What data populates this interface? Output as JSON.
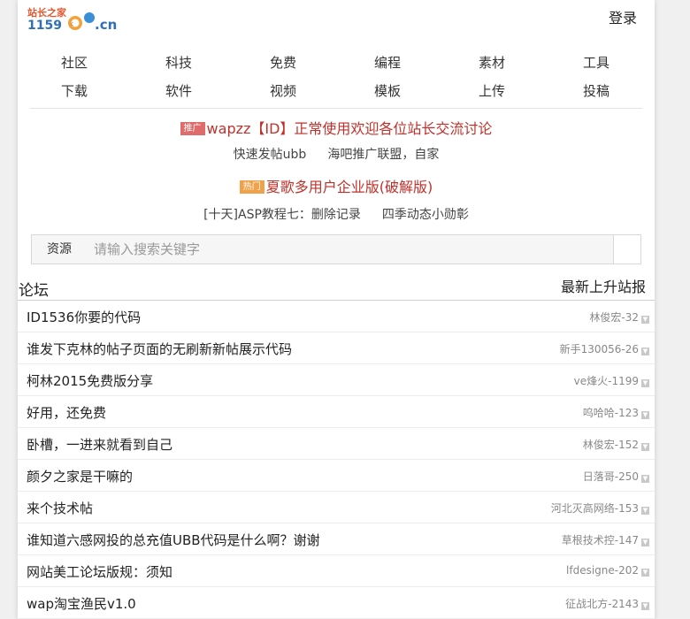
{
  "header": {
    "login_label": "登录"
  },
  "nav": {
    "row1": [
      "社区",
      "科技",
      "免费",
      "编程",
      "素材",
      "工具"
    ],
    "row2": [
      "下载",
      "软件",
      "视频",
      "模板",
      "上传",
      "投稿"
    ]
  },
  "promo1": {
    "badge": "推广",
    "badge_color": "#e06b6b",
    "text": "wapzz【ID】正常使用欢迎各位站长交流讨论",
    "links": [
      "快速发帖ubb",
      "海吧推广联盟，自家"
    ]
  },
  "promo2": {
    "badge": "热门",
    "badge_color": "#f0a24a",
    "text": "夏歌多用户企业版(破解版)",
    "links": [
      "[十天]ASP教程七：删除记录",
      "四季动态小勋彰"
    ]
  },
  "search": {
    "category": "资源",
    "placeholder": "请输入搜索关键字",
    "value": ""
  },
  "section": {
    "title": "论坛",
    "link": "最新上升站报"
  },
  "posts": [
    {
      "title": "ID1536你要的代码",
      "meta": "林俊宏-32"
    },
    {
      "title": "谁发下克林的帖子页面的无刷新新帖展示代码",
      "meta": "新手130056-26"
    },
    {
      "title": "柯林2015免费版分享",
      "meta": "ve烽火-1199"
    },
    {
      "title": "好用，还免费",
      "meta": "呜哈哈-123"
    },
    {
      "title": "卧槽，一进来就看到自己",
      "meta": "林俊宏-152"
    },
    {
      "title": "颜夕之家是干嘛的",
      "meta": "日落哥-250"
    },
    {
      "title": "来个技术帖",
      "meta": "河北灭高网络-153"
    },
    {
      "title": "谁知道六感网投的总充值UBB代码是什么啊？谢谢",
      "meta": "草根技术控-147"
    },
    {
      "title": "网站美工论坛版规：须知",
      "meta": "lfdesigne-202"
    },
    {
      "title": "wap淘宝渔民v1.0",
      "meta": "征战北方-2143"
    }
  ]
}
